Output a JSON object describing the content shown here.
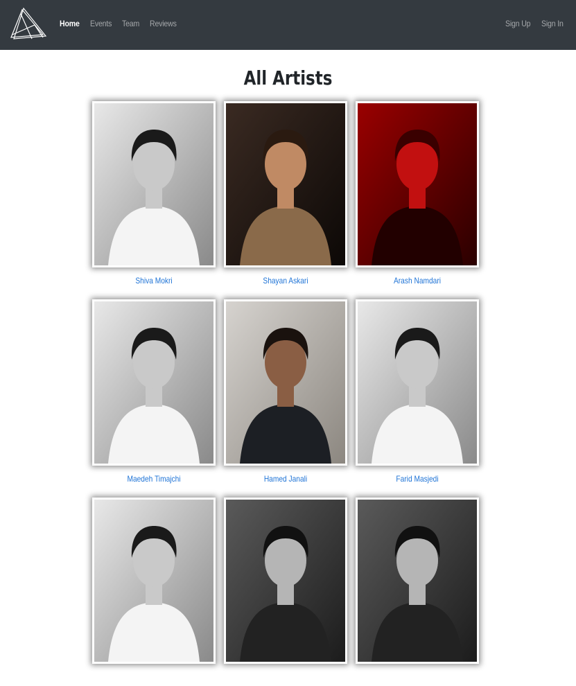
{
  "nav": {
    "left": [
      {
        "label": "Home",
        "active": true
      },
      {
        "label": "Events",
        "active": false
      },
      {
        "label": "Team",
        "active": false
      },
      {
        "label": "Reviews",
        "active": false
      }
    ],
    "right": [
      {
        "label": "Sign Up"
      },
      {
        "label": "Sign In"
      }
    ]
  },
  "page": {
    "title": "All Artists"
  },
  "artists": [
    {
      "name": "Shiva Mokri",
      "tone": "bw-light"
    },
    {
      "name": "Shayan Askari",
      "tone": "color-dark"
    },
    {
      "name": "Arash Namdari",
      "tone": "red"
    },
    {
      "name": "Maedeh Timajchi",
      "tone": "bw-light"
    },
    {
      "name": "Hamed Janali",
      "tone": "color-grey"
    },
    {
      "name": "Farid Masjedi",
      "tone": "bw-light"
    },
    {
      "name": "",
      "tone": "bw-light"
    },
    {
      "name": "",
      "tone": "bw-dark"
    },
    {
      "name": "",
      "tone": "bw-dark"
    }
  ],
  "colors": {
    "navbar": "#343a40",
    "link": "#1e73d6",
    "red_photo": "#7a0000"
  }
}
